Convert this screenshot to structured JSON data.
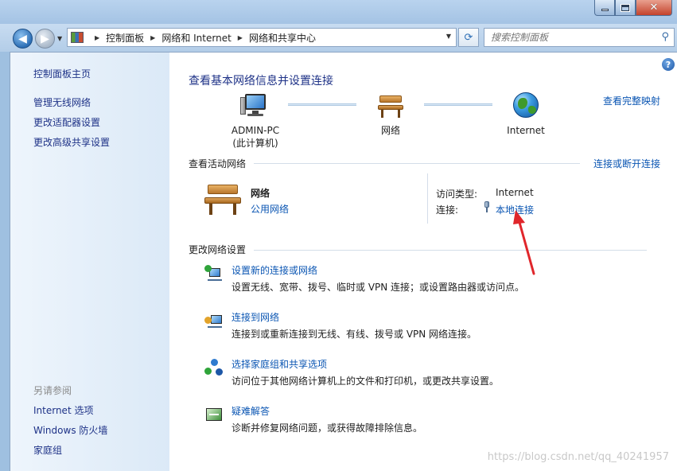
{
  "address": {
    "crumbs": [
      "控制面板",
      "网络和 Internet",
      "网络和共享中心"
    ]
  },
  "search": {
    "placeholder": "搜索控制面板"
  },
  "sidebar": {
    "home": "控制面板主页",
    "tasks": [
      "管理无线网络",
      "更改适配器设置",
      "更改高级共享设置"
    ],
    "see_also_title": "另请参阅",
    "see_also": [
      "Internet 选项",
      "Windows 防火墙",
      "家庭组"
    ]
  },
  "main": {
    "title": "查看基本网络信息并设置连接",
    "view_full_map": "查看完整映射",
    "map": {
      "computer_name": "ADMIN-PC",
      "computer_sub": "(此计算机)",
      "network_label": "网络",
      "internet_label": "Internet"
    },
    "active": {
      "heading": "查看活动网络",
      "connect_disconnect": "连接或断开连接",
      "network_name": "网络",
      "network_type": "公用网络",
      "access_type_key": "访问类型:",
      "access_type_val": "Internet",
      "connections_key": "连接:",
      "connections_val": "本地连接"
    },
    "settings": {
      "heading": "更改网络设置",
      "tasks": [
        {
          "link": "设置新的连接或网络",
          "desc": "设置无线、宽带、拨号、临时或 VPN 连接；或设置路由器或访问点。"
        },
        {
          "link": "连接到网络",
          "desc": "连接到或重新连接到无线、有线、拨号或 VPN 网络连接。"
        },
        {
          "link": "选择家庭组和共享选项",
          "desc": "访问位于其他网络计算机上的文件和打印机，或更改共享设置。"
        },
        {
          "link": "疑难解答",
          "desc": "诊断并修复网络问题，或获得故障排除信息。"
        }
      ]
    }
  },
  "watermark": "https://blog.csdn.net/qq_40241957",
  "colors": {
    "link": "#0b56b3",
    "arrow": "#e0262b",
    "sidebar": "#dbe9f7"
  }
}
